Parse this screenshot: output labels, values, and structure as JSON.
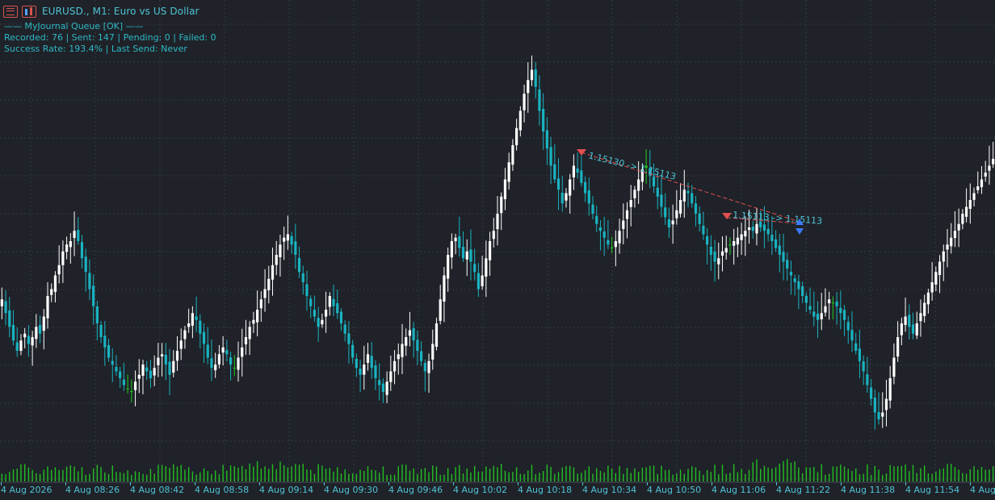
{
  "window": {
    "symbol_title": "EURUSD., M1:  Euro vs US Dollar",
    "info_line_1": "—— MyJournal Queue [OK] ——",
    "info_line_2": "Recorded: 76 | Sent: 147 | Pending: 0 | Failed: 0",
    "info_line_3": "Success Rate: 193.4% | Last Send: Never"
  },
  "icons": {
    "left": "list-icon",
    "right": "chart-bars-icon"
  },
  "colors": {
    "background": "#1f2228",
    "grid": "#343944",
    "bull_candle": "#ffffff",
    "bear_candle": "#19b3c1",
    "doji_candle": "#22cc22",
    "volume": "#22c022",
    "trade_line": "#e05050",
    "text": "#4fc3d6"
  },
  "time_axis": [
    "4 Aug 2026",
    "4 Aug 08:26",
    "4 Aug 08:42",
    "4 Aug 08:58",
    "4 Aug 09:14",
    "4 Aug 09:30",
    "4 Aug 09:46",
    "4 Aug 10:02",
    "4 Aug 10:18",
    "4 Aug 10:34",
    "4 Aug 10:50",
    "4 Aug 11:06",
    "4 Aug 11:22",
    "4 Aug 11:38",
    "4 Aug 11:54",
    "4 Aug"
  ],
  "trades": [
    {
      "label": "1.15130 -> 1.15113"
    },
    {
      "label": "1.15113 -> 1.15113"
    }
  ],
  "chart_data": {
    "type": "candlestick",
    "interval": "M1",
    "bars": 246,
    "closes": [
      0.35,
      0.31,
      0.27,
      0.23,
      0.2,
      0.23,
      0.25,
      0.22,
      0.24,
      0.27,
      0.25,
      0.3,
      0.36,
      0.38,
      0.42,
      0.45,
      0.49,
      0.51,
      0.52,
      0.55,
      0.52,
      0.47,
      0.43,
      0.38,
      0.33,
      0.28,
      0.24,
      0.21,
      0.18,
      0.16,
      0.14,
      0.12,
      0.1,
      0.09,
      0.08,
      0.11,
      0.13,
      0.16,
      0.14,
      0.12,
      0.15,
      0.18,
      0.19,
      0.16,
      0.13,
      0.17,
      0.2,
      0.23,
      0.26,
      0.28,
      0.31,
      0.29,
      0.25,
      0.22,
      0.18,
      0.15,
      0.16,
      0.19,
      0.21,
      0.19,
      0.16,
      0.15,
      0.18,
      0.21,
      0.24,
      0.27,
      0.29,
      0.32,
      0.35,
      0.38,
      0.41,
      0.45,
      0.48,
      0.51,
      0.53,
      0.54,
      0.51,
      0.48,
      0.43,
      0.4,
      0.36,
      0.33,
      0.3,
      0.27,
      0.29,
      0.32,
      0.36,
      0.33,
      0.31,
      0.28,
      0.25,
      0.22,
      0.18,
      0.15,
      0.13,
      0.16,
      0.19,
      0.15,
      0.12,
      0.1,
      0.08,
      0.11,
      0.14,
      0.17,
      0.19,
      0.22,
      0.24,
      0.26,
      0.23,
      0.2,
      0.17,
      0.14,
      0.17,
      0.22,
      0.28,
      0.35,
      0.42,
      0.48,
      0.52,
      0.53,
      0.5,
      0.47,
      0.49,
      0.46,
      0.43,
      0.38,
      0.42,
      0.47,
      0.52,
      0.55,
      0.6,
      0.65,
      0.7,
      0.75,
      0.8,
      0.85,
      0.9,
      0.95,
      0.99,
      1.02,
      0.97,
      0.9,
      0.84,
      0.79,
      0.74,
      0.7,
      0.67,
      0.63,
      0.66,
      0.7,
      0.74,
      0.72,
      0.69,
      0.66,
      0.63,
      0.6,
      0.57,
      0.55,
      0.53,
      0.51,
      0.5,
      0.52,
      0.55,
      0.58,
      0.61,
      0.64,
      0.67,
      0.7,
      0.73,
      0.74,
      0.71,
      0.68,
      0.65,
      0.62,
      0.59,
      0.56,
      0.58,
      0.61,
      0.64,
      0.67,
      0.66,
      0.63,
      0.6,
      0.57,
      0.54,
      0.51,
      0.48,
      0.46,
      0.47,
      0.49,
      0.5,
      0.51,
      0.52,
      0.53,
      0.54,
      0.55,
      0.56,
      0.55,
      0.57,
      0.56,
      0.55,
      0.54,
      0.52,
      0.5,
      0.48,
      0.46,
      0.44,
      0.42,
      0.4,
      0.38,
      0.36,
      0.34,
      0.32,
      0.3,
      0.29,
      0.31,
      0.33,
      0.35,
      0.34,
      0.33,
      0.31,
      0.29,
      0.26,
      0.23,
      0.2,
      0.17,
      0.14,
      0.1,
      0.06,
      0.02,
      0.0,
      0.02,
      0.06,
      0.12,
      0.18,
      0.24,
      0.28,
      0.3,
      0.27,
      0.25,
      0.28,
      0.31,
      0.34,
      0.37,
      0.4,
      0.43,
      0.46,
      0.49,
      0.51,
      0.53,
      0.55,
      0.57,
      0.6,
      0.62,
      0.64,
      0.66,
      0.68,
      0.7,
      0.72,
      0.74,
      0.76
    ]
  }
}
